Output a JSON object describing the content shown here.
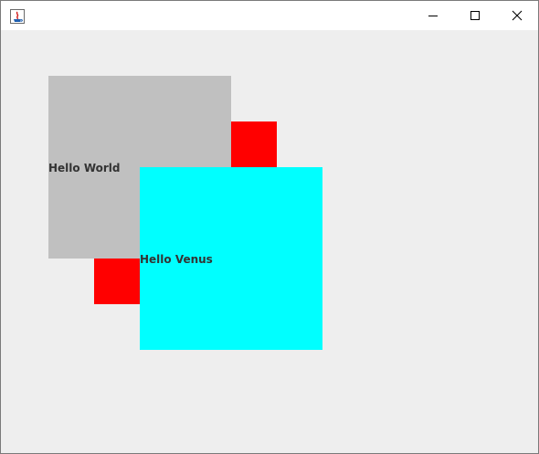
{
  "window": {
    "title": "",
    "icons": {
      "app": "java-app-icon",
      "minimize": "minimize-icon",
      "maximize": "maximize-icon",
      "close": "close-icon"
    }
  },
  "panels": {
    "gray": {
      "label": "Hello World",
      "color": "#c0c0c0"
    },
    "cyan": {
      "label": "Hello Venus",
      "color": "#00ffff"
    },
    "red_color": "#ff0000"
  }
}
